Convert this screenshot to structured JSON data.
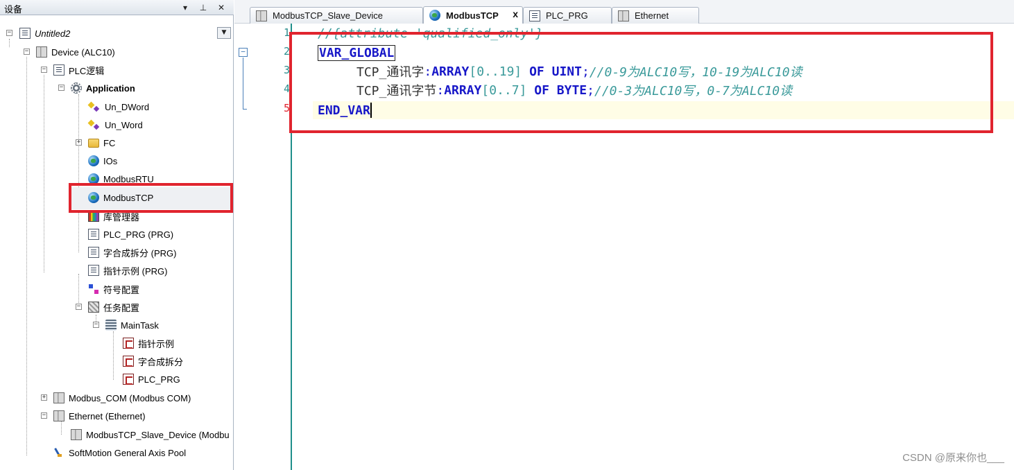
{
  "panel": {
    "title": "设备",
    "pin_glyph": "▾",
    "dock_glyph": "⊥",
    "close_glyph": "✕",
    "dropdown_glyph": "▼"
  },
  "tree": {
    "project": "Untitled2",
    "device": "Device (ALC10)",
    "plc_logic": "PLC逻辑",
    "application": "Application",
    "un_dword": "Un_DWord",
    "un_word": "Un_Word",
    "fc": "FC",
    "ios": "IOs",
    "modbus_rtu": "ModbusRTU",
    "modbus_tcp": "ModbusTCP",
    "library_manager": "库管理器",
    "plc_prg": "PLC_PRG (PRG)",
    "word_split": "字合成拆分 (PRG)",
    "pointer_example": "指针示例 (PRG)",
    "symbol_config": "符号配置",
    "task_config": "任务配置",
    "main_task": "MainTask",
    "task_pointer_example": "指针示例",
    "task_word_split": "字合成拆分",
    "task_plc_prg": "PLC_PRG",
    "modbus_com": "Modbus_COM (Modbus COM)",
    "ethernet": "Ethernet (Ethernet)",
    "modbus_tcp_slave": "ModbusTCP_Slave_Device (Modbu",
    "softmotion_pool": "SoftMotion General Axis Pool"
  },
  "tabs": [
    {
      "label": "ModbusTCP_Slave_Device",
      "active": false
    },
    {
      "label": "ModbusTCP",
      "active": true,
      "close": "x"
    },
    {
      "label": "PLC_PRG",
      "active": false
    },
    {
      "label": "Ethernet",
      "active": false
    }
  ],
  "editor": {
    "line_numbers": [
      "1",
      "2",
      "3",
      "4",
      "5"
    ],
    "fold_glyph": "−",
    "line1": "//{attribute 'qualified_only'}",
    "line2_kw": "VAR_GLOBAL",
    "line3": {
      "name": "TCP_通讯字",
      "colon": ":",
      "array_kw": "ARRAY",
      "range": "[0..19]",
      "of_kw": "OF",
      "type_kw": "UINT",
      "semicolon": ";",
      "comment": "//0-9为ALC10写，10-19为ALC10读"
    },
    "line4": {
      "name": "TCP_通讯字节",
      "colon": ":",
      "array_kw": "ARRAY",
      "range": "[0..7]",
      "of_kw": "OF",
      "type_kw": "BYTE",
      "semicolon": ";",
      "comment": "//0-3为ALC10写，0-7为ALC10读"
    },
    "line5_kw": "END_VAR"
  },
  "watermark": "CSDN @原来你也___",
  "colors": {
    "highlight_red": "#e0242e",
    "keyword_blue": "#1717c8",
    "comment_teal": "#3a9a9a"
  }
}
